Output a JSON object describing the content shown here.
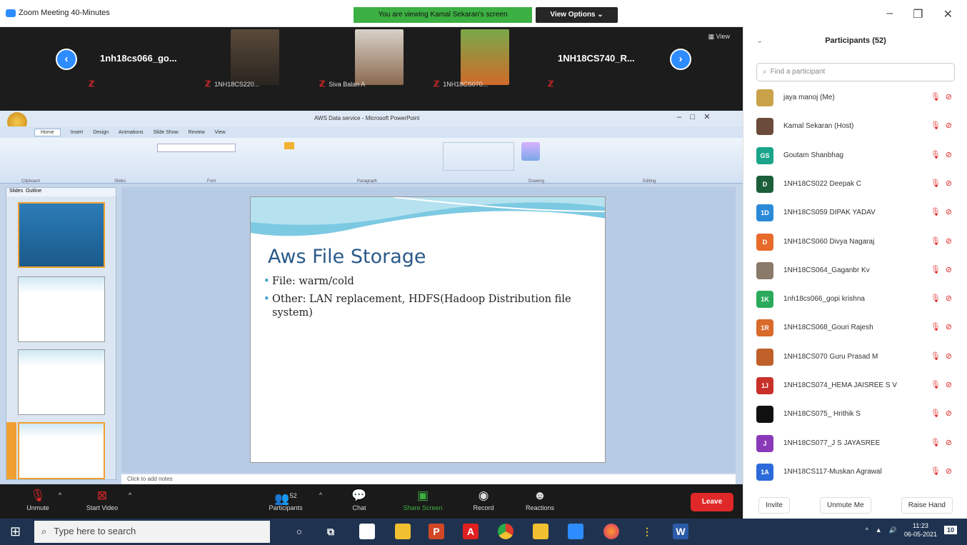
{
  "window": {
    "title": "Zoom Meeting 40-Minutes",
    "viewing_banner": "You are viewing Kamal Sekaran's screen",
    "view_options": "View Options ⌄"
  },
  "strip": {
    "view_label": "▦ View",
    "tiles": [
      {
        "name": "1nh18cs066_go..."
      },
      {
        "label": "1NH18CS220..."
      },
      {
        "label": "Siva Balan A"
      },
      {
        "label": "1NH18CS070..."
      },
      {
        "name": "1NH18CS740_R..."
      }
    ]
  },
  "ppt": {
    "title": "AWS Data service - Microsoft PowerPoint",
    "tabs": [
      "Home",
      "Insert",
      "Design",
      "Animations",
      "Slide Show",
      "Review",
      "View"
    ],
    "groups": [
      "Clipboard",
      "Slides",
      "Font",
      "Paragraph",
      "Drawing",
      "Editing"
    ],
    "pane_tabs": [
      "Slides",
      "Outline"
    ],
    "slide": {
      "title": "Aws File Storage",
      "bullets": [
        "File: warm/cold",
        "Other: LAN replacement, HDFS(Hadoop Distribution file system)"
      ]
    },
    "notes_placeholder": "Click to add notes"
  },
  "panel": {
    "title": "Participants (52)",
    "search_placeholder": "Find a participant",
    "participants": [
      {
        "name": "jaya manoj (Me)",
        "initials": "",
        "color": "#c9a24a"
      },
      {
        "name": "Kamal Sekaran (Host)",
        "initials": "",
        "color": "#6b4b3a"
      },
      {
        "name": "Goutam Shanbhag",
        "initials": "GS",
        "color": "#1aa58a"
      },
      {
        "name": "1NH18CS022 Deepak C",
        "initials": "D",
        "color": "#1b5e3a"
      },
      {
        "name": "1NH18CS059 DIPAK YADAV",
        "initials": "1D",
        "color": "#2b8ad8"
      },
      {
        "name": "1NH18CS060 Divya Nagaraj",
        "initials": "D",
        "color": "#e86a2a"
      },
      {
        "name": "1NH18CS064_Gaganbr Kv",
        "initials": "",
        "color": "#8a7a6a"
      },
      {
        "name": "1nh18cs066_gopi krishna",
        "initials": "1K",
        "color": "#2aaa5a"
      },
      {
        "name": "1NH18CS068_Gouri Rajesh",
        "initials": "1R",
        "color": "#d86a2a"
      },
      {
        "name": "1NH18CS070 Guru Prasad M",
        "initials": "",
        "color": "#c0602a"
      },
      {
        "name": "1NH18CS074_HEMA JAISREE S V",
        "initials": "1J",
        "color": "#c8302a"
      },
      {
        "name": "1NH18CS075_ Hrithik S",
        "initials": "",
        "color": "#111111"
      },
      {
        "name": "1NH18CS077_J S JAYASREE",
        "initials": "J",
        "color": "#8a3ab8"
      },
      {
        "name": "1NH18CS117-Muskan Agrawal",
        "initials": "1A",
        "color": "#2b6ad8"
      }
    ],
    "invite": "Invite",
    "unmute_me": "Unmute Me",
    "raise_hand": "Raise Hand"
  },
  "toolbar": {
    "unmute": "Unmute",
    "start_video": "Start Video",
    "participants": "Participants",
    "participants_count": "52",
    "chat": "Chat",
    "share_screen": "Share Screen",
    "record": "Record",
    "reactions": "Reactions",
    "leave": "Leave"
  },
  "taskbar": {
    "search": "Type here to search",
    "time": "11:23",
    "date": "06-05-2021",
    "notif": "10"
  }
}
